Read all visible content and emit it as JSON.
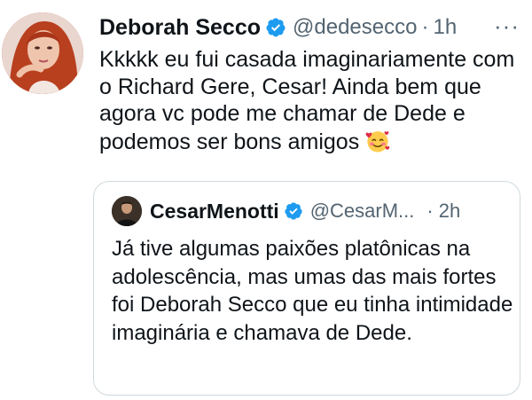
{
  "tweet": {
    "display_name": "Deborah Secco",
    "handle": "@dedesecco",
    "separator": "·",
    "time": "1h",
    "more_label": "···",
    "text": "Kkkkk eu fui casada imaginariamente com o Richard Gere, Cesar! Ainda bem que agora vc pode me chamar de Dede e podemos ser bons amigos",
    "emoji": "smiling-face-with-hearts"
  },
  "quoted": {
    "display_name": "CesarMenotti",
    "handle": "@CesarM...",
    "separator": "·",
    "time": "2h",
    "text": "Já tive algumas paixões platônicas na adolescência, mas umas das mais fortes foi Deborah Secco que eu tinha intimidade imaginária e chamava de Dede."
  },
  "colors": {
    "verified": "#1d9bf0",
    "secondary_text": "#536471",
    "border": "#cfd9de"
  }
}
